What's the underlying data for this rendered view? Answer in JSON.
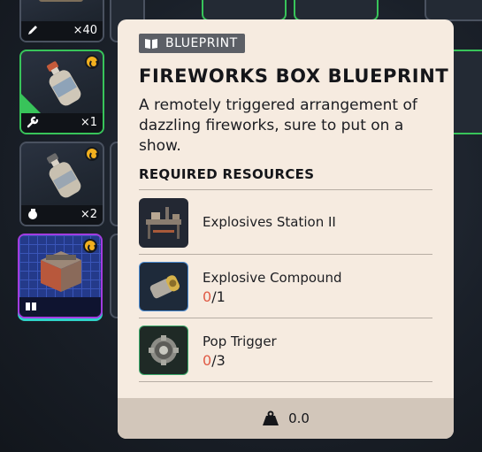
{
  "inventory": {
    "slots": [
      {
        "id": "top-left",
        "qty": "×40"
      },
      {
        "id": "bottle-1",
        "qty": "×1"
      },
      {
        "id": "bottle-2",
        "qty": "×2"
      },
      {
        "id": "blueprint-slot",
        "qty": ""
      }
    ]
  },
  "tooltip": {
    "badge": "BLUEPRINT",
    "title": "FIREWORKS BOX BLUEPRINT",
    "description": "A remotely triggered arrangement of dazzling fireworks, sure to put on a show.",
    "resources_header": "REQUIRED RESOURCES",
    "resources": [
      {
        "name": "Explosives Station II",
        "have": "",
        "sep": "",
        "need": ""
      },
      {
        "name": "Explosive Compound",
        "have": "0",
        "sep": "/",
        "need": "1"
      },
      {
        "name": "Pop Trigger",
        "have": "0",
        "sep": "/",
        "need": "3"
      }
    ],
    "weight": "0.0"
  },
  "colors": {
    "tooltip_bg": "#f6ebe0",
    "footer_bg": "#d2c6ba",
    "missing_count": "#e05a45",
    "rarity_green": "#38c45a",
    "blueprint_purple": "#a23ce0",
    "tag_gold": "#f2b01e"
  }
}
